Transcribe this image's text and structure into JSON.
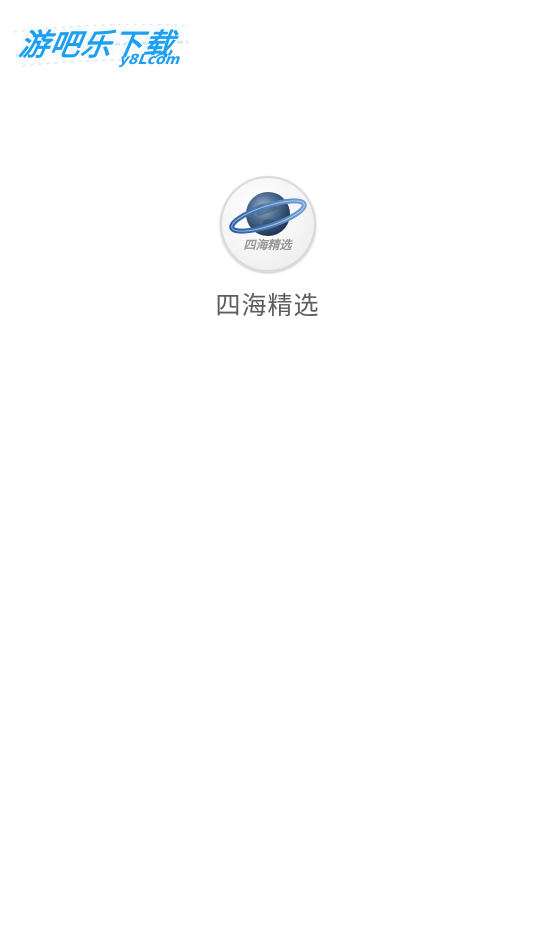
{
  "watermark": {
    "main_text": "游吧乐下载",
    "sub_text": "y8Lcom",
    "color": "#1ea0f2"
  },
  "app": {
    "icon_label": "四海精选",
    "name": "四海精选"
  }
}
